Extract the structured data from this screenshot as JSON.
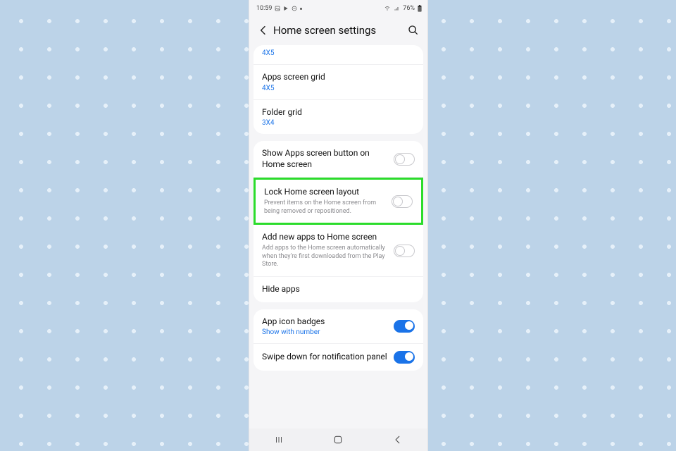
{
  "statusbar": {
    "time": "10:59",
    "battery": "76%"
  },
  "header": {
    "title": "Home screen settings"
  },
  "card1": {
    "cutoff_value": "4X5",
    "row1": {
      "title": "Apps screen grid",
      "value": "4X5"
    },
    "row2": {
      "title": "Folder grid",
      "value": "3X4"
    }
  },
  "card2": {
    "row1": {
      "title": "Show Apps screen button on Home screen"
    },
    "row2": {
      "title": "Lock Home screen layout",
      "desc": "Prevent items on the Home screen from being removed or repositioned."
    },
    "row3": {
      "title": "Add new apps to Home screen",
      "desc": "Add apps to the Home screen automatically when they're first downloaded from the Play Store."
    },
    "row4": {
      "title": "Hide apps"
    }
  },
  "card3": {
    "row1": {
      "title": "App icon badges",
      "value": "Show with number"
    },
    "row2": {
      "title": "Swipe down for notification panel"
    }
  }
}
